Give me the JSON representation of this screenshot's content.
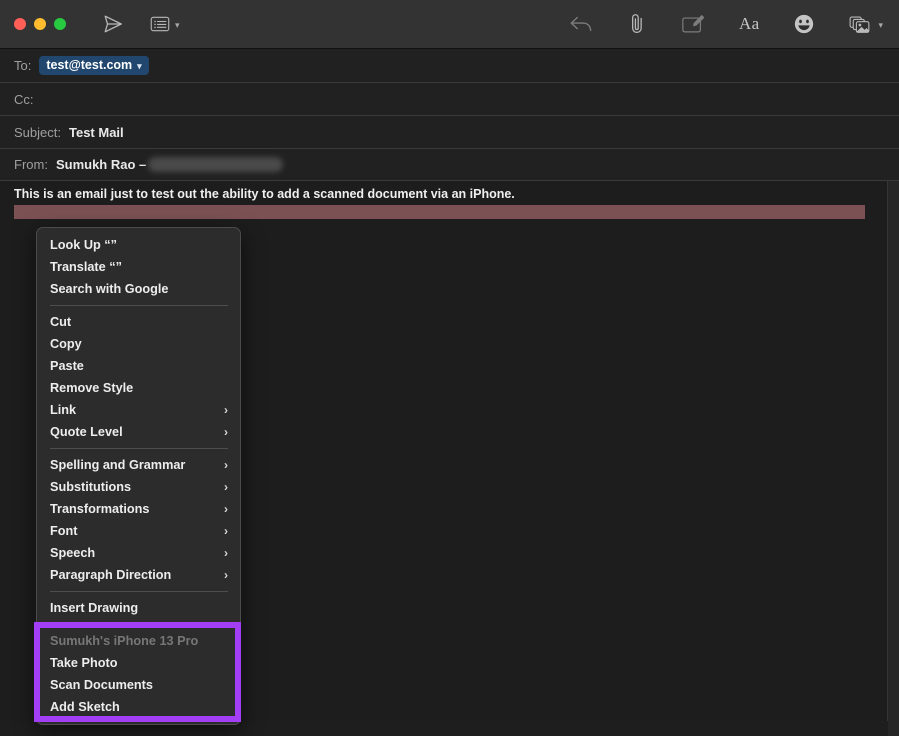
{
  "window": {
    "traffic_lights": [
      "close",
      "minimize",
      "maximize"
    ],
    "colors": {
      "close": "#ff5f57",
      "minimize": "#febc2e",
      "maximize": "#28c840",
      "toolbar_bg": "#333333",
      "menu_bg": "#2c2c2c",
      "highlight_purple": "#a23ef5",
      "selection_maroon": "#7c5154",
      "recipient_token_blue": "#21476f"
    }
  },
  "toolbar": {
    "left_icons": [
      {
        "name": "send-icon",
        "label": "Send"
      },
      {
        "name": "header-fields-icon",
        "label": "Header Fields",
        "chevron": "⌄"
      }
    ],
    "right_icons": [
      {
        "name": "reply-icon",
        "label": "Reply"
      },
      {
        "name": "attach-icon",
        "label": "Attach"
      },
      {
        "name": "markup-icon",
        "label": "Markup"
      },
      {
        "name": "format-text-icon",
        "label": "Aa"
      },
      {
        "name": "emoji-icon",
        "label": "Emoji & Symbols"
      },
      {
        "name": "photo-browser-icon",
        "label": "Photo Browser",
        "chevron": "⌄"
      }
    ]
  },
  "compose": {
    "fields": [
      {
        "label": "To:",
        "value": "test@test.com",
        "type": "token",
        "chevron": "⌄"
      },
      {
        "label": "Cc:",
        "value": "",
        "type": "text"
      },
      {
        "label": "Subject:",
        "value": "Test Mail",
        "type": "text"
      },
      {
        "label": "From:",
        "value": "Sumukh Rao –",
        "type": "text_redacted"
      }
    ],
    "body_text": "This is an email just to test out the ability to add a scanned document via an iPhone."
  },
  "context_menu": {
    "groups": [
      {
        "name": "lookup-group",
        "items": [
          {
            "label": "Look Up “”",
            "submenu": false,
            "disabled": false
          },
          {
            "label": "Translate “”",
            "submenu": false,
            "disabled": false
          },
          {
            "label": "Search with Google",
            "submenu": false,
            "disabled": false
          }
        ]
      },
      {
        "name": "edit-group",
        "items": [
          {
            "label": "Cut",
            "submenu": false,
            "disabled": false
          },
          {
            "label": "Copy",
            "submenu": false,
            "disabled": false
          },
          {
            "label": "Paste",
            "submenu": false,
            "disabled": false
          },
          {
            "label": "Remove Style",
            "submenu": false,
            "disabled": false
          },
          {
            "label": "Link",
            "submenu": true,
            "disabled": false
          },
          {
            "label": "Quote Level",
            "submenu": true,
            "disabled": false
          }
        ]
      },
      {
        "name": "text-tools-group",
        "items": [
          {
            "label": "Spelling and Grammar",
            "submenu": true,
            "disabled": false
          },
          {
            "label": "Substitutions",
            "submenu": true,
            "disabled": false
          },
          {
            "label": "Transformations",
            "submenu": true,
            "disabled": false
          },
          {
            "label": "Font",
            "submenu": true,
            "disabled": false
          },
          {
            "label": "Speech",
            "submenu": true,
            "disabled": false
          },
          {
            "label": "Paragraph Direction",
            "submenu": true,
            "disabled": false
          }
        ]
      },
      {
        "name": "drawing-group",
        "items": [
          {
            "label": "Insert Drawing",
            "submenu": false,
            "disabled": false
          }
        ]
      },
      {
        "name": "continuity-camera-group",
        "highlighted": true,
        "items": [
          {
            "label": "Sumukh's iPhone 13 Pro",
            "submenu": false,
            "disabled": true
          },
          {
            "label": "Take Photo",
            "submenu": false,
            "disabled": false
          },
          {
            "label": "Scan Documents",
            "submenu": false,
            "disabled": false
          },
          {
            "label": "Add Sketch",
            "submenu": false,
            "disabled": false
          }
        ]
      }
    ],
    "submenu_arrow": "›"
  }
}
